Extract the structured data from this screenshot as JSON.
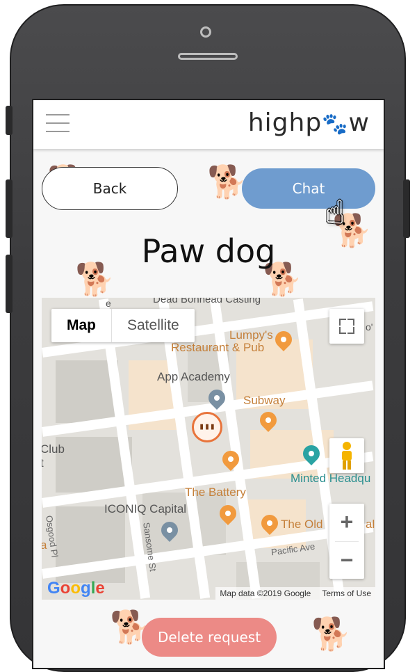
{
  "app": {
    "logo_prefix": "highp",
    "logo_suffix": "w",
    "logo_paw": "🐾"
  },
  "header": {
    "menu_icon": "hamburger-icon"
  },
  "actions": {
    "back_label": "Back",
    "chat_label": "Chat",
    "delete_label": "Delete request"
  },
  "dog": {
    "name": "Paw dog"
  },
  "map": {
    "toggle": {
      "map_label": "Map",
      "satellite_label": "Satellite",
      "selected": "Map"
    },
    "zoom_in": "+",
    "zoom_out": "−",
    "places": {
      "top_cut": "Dead Bonhead Casting",
      "restaurant_line1": "Lumpy's",
      "restaurant_line2": "Restaurant & Pub",
      "app_academy": "App Academy",
      "subway": "Subway",
      "club_line1": "Club",
      "club_line2": "t",
      "minted": "Minted Headqu",
      "battery": "The Battery",
      "iconiq": "ICONIQ Capital",
      "old": "The Old",
      "edge_e": "e",
      "edge_al": "al",
      "edge_a": "a",
      "edge_o": "o'"
    },
    "streets": {
      "osgood": "Osgood Pl",
      "sansome": "Sansome St",
      "pacific": "Pacific Ave"
    },
    "google_logo": "Google",
    "map_data": "Map data ©2019 Google",
    "terms": "Terms of Use",
    "colors": {
      "accent_orange": "#f19a3e",
      "pin_blue": "#7990a3",
      "pin_teal": "#2aa3a3"
    }
  },
  "colors": {
    "chat_button": "#6f9ccf",
    "delete_button": "#ec8a86",
    "paw_pink": "#e89090"
  }
}
